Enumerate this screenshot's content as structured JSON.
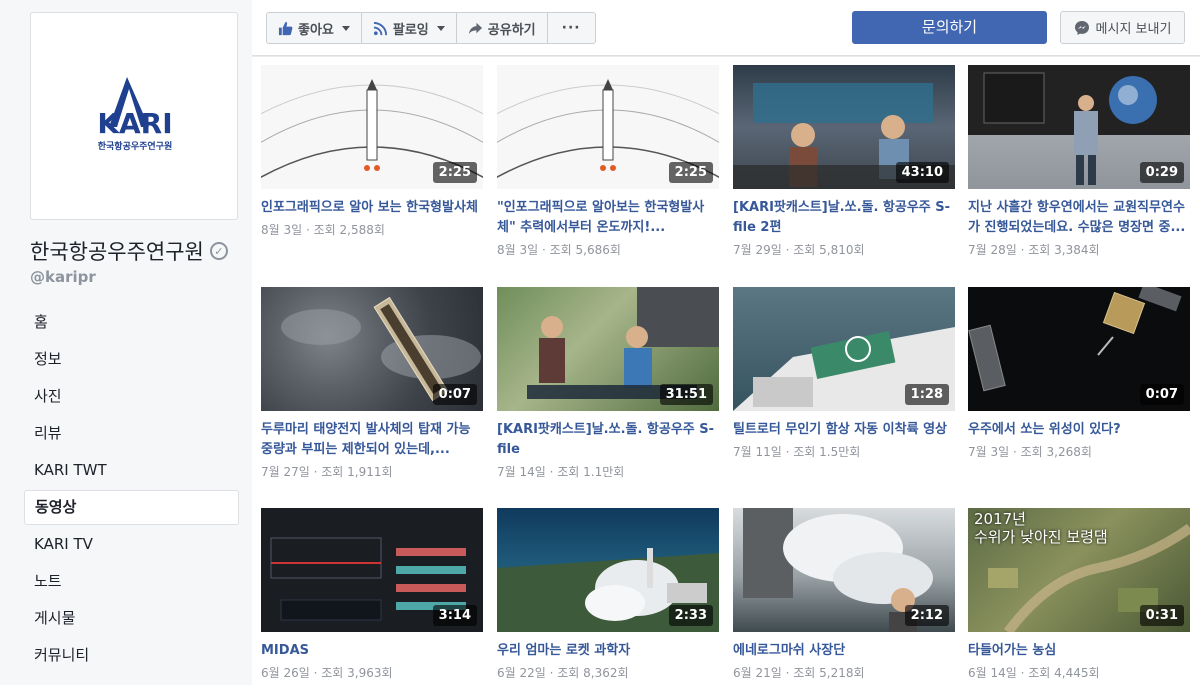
{
  "page": {
    "name": "한국항공우주연구원",
    "handle": "@karipr",
    "logo_text": "KARI",
    "logo_subtext": "한국항공우주연구원"
  },
  "sidebar": {
    "items": [
      {
        "label": "홈"
      },
      {
        "label": "정보"
      },
      {
        "label": "사진"
      },
      {
        "label": "리뷰"
      },
      {
        "label": "KARI TWT"
      },
      {
        "label": "동영상",
        "active": true
      },
      {
        "label": "KARI TV"
      },
      {
        "label": "노트"
      },
      {
        "label": "게시물"
      },
      {
        "label": "커뮤니티"
      }
    ]
  },
  "toolbar": {
    "like_label": "좋아요",
    "follow_label": "팔로잉",
    "share_label": "공유하기",
    "more_label": "···",
    "contact_label": "문의하기",
    "message_label": "메시지 보내기"
  },
  "videos": [
    {
      "title": "인포그래픽으로 알아 보는 한국형발사체",
      "meta": "8월 3일 · 조회 2,588회",
      "duration": "2:25",
      "thumb": "t-white"
    },
    {
      "title": "\"인포그래픽으로 알아보는 한국형발사체\" 추력에서부터 온도까지!...",
      "meta": "8월 3일 · 조회 5,686회",
      "duration": "2:25",
      "thumb": "t-white"
    },
    {
      "title": "[KARI팟캐스트]날.쏘.돌. 항공우주 S-file 2편",
      "meta": "7월 29일 · 조회 5,810회",
      "duration": "43:10",
      "thumb": "t-studio"
    },
    {
      "title": "지난 사흘간 항우연에서는 교원직무연수가 진행되었는데요. 수많은 명장면 중...",
      "meta": "7월 28일 · 조회 3,384회",
      "duration": "0:29",
      "thumb": "t-gallery"
    },
    {
      "title": "두루마리 태양전지 발사체의 탑재 가능 중량과 부피는 제한되어 있는데,...",
      "meta": "7월 27일 · 조회 1,911회",
      "duration": "0:07",
      "thumb": "t-clouds"
    },
    {
      "title": "[KARI팟캐스트]날.쏘.돌. 항공우주 S-file",
      "meta": "7월 14일 · 조회 1.1만회",
      "duration": "31:51",
      "thumb": "t-green"
    },
    {
      "title": "틸트로터 무인기 함상 자동 이착륙 영상",
      "meta": "7월 11일 · 조회 1.5만회",
      "duration": "1:28",
      "thumb": "t-sea"
    },
    {
      "title": "우주에서 쏘는 위성이 있다?",
      "meta": "7월 3일 · 조회 3,268회",
      "duration": "0:07",
      "thumb": "t-space"
    },
    {
      "title": "MIDAS",
      "meta": "6월 26일 · 조회 3,963회",
      "duration": "3:14",
      "thumb": "t-dark"
    },
    {
      "title": "우리 엄마는 로켓 과학자",
      "meta": "6월 22일 · 조회 8,362회",
      "duration": "2:33",
      "thumb": "t-rocket"
    },
    {
      "title": "에네로그마쉬 사장단",
      "meta": "6월 21일 · 조회 5,218회",
      "duration": "2:12",
      "thumb": "t-smoke"
    },
    {
      "title": "타들어가는 농심",
      "meta": "6월 14일 · 조회 4,445회",
      "duration": "0:31",
      "thumb": "t-aerial"
    }
  ],
  "thumb_overlay_texts": {
    "v12_line1": "2017년",
    "v12_line2": "수위가 낮아진 보령댐"
  },
  "colors": {
    "brand_blue": "#4267b2",
    "link_blue": "#365899",
    "meta_gray": "#90949c",
    "logo_blue": "#1f3f8f"
  }
}
